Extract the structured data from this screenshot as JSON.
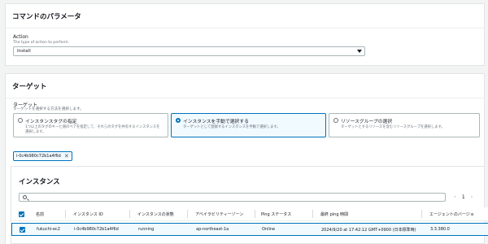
{
  "params_panel": {
    "title": "コマンドのパラメータ",
    "action_label": "Action",
    "action_desc": "The type of action to perform.",
    "action_value": "Install"
  },
  "target_panel": {
    "title": "ターゲット",
    "target_label": "ターゲット",
    "target_desc": "ターゲットを選択する方法を選択します。",
    "options": [
      {
        "title": "インスタンスタグの指定",
        "desc": "1つ以上のタグのキーと値のペアを指定して、それらのタグを共有するインスタンスを選択します。",
        "selected": false
      },
      {
        "title": "インスタンスを手動で選択する",
        "desc": "ターゲットとして登録するインスタンスを手動で選択します。",
        "selected": true
      },
      {
        "title": "リソースグループの選択",
        "desc": "ターゲットとするリソースを含むリソースグループを選択します。",
        "selected": false
      }
    ],
    "token": "i-0c4b980c72b1a4f6d"
  },
  "instances": {
    "title": "インスタンス",
    "page": "1",
    "columns": [
      "名前",
      "インスタンス ID",
      "インスタンスの状態",
      "アベイラビリティーゾーン",
      "Ping ステータス",
      "最終 ping 時間",
      "エージェントのバージョ"
    ],
    "rows": [
      {
        "name": "fukuchi-ec2",
        "id": "i-0c4b980c72b1a4f6d",
        "state": "running",
        "az": "ap-northeast-1a",
        "ping": "Online",
        "last_ping": "2024/9/20 at 17:42:12 GMT+0900 (日本標準時)",
        "agent": "3.3.380.0"
      }
    ]
  },
  "colors": {
    "accent": "#0073bb",
    "page_bg": "#f2f3f3"
  }
}
